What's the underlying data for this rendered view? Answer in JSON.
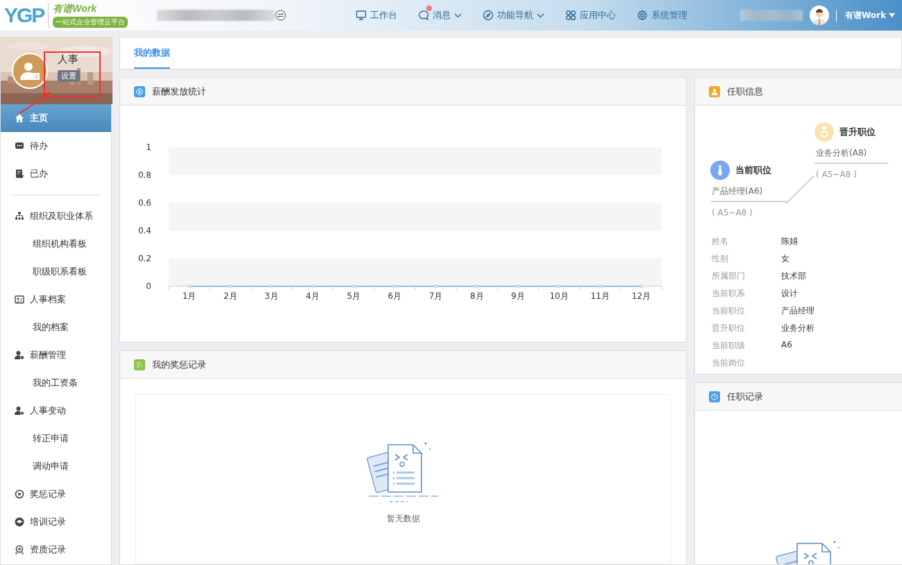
{
  "logo": {
    "mark": "YGP",
    "brand": "有谱Work",
    "tagline": "一站式企业管理云平台"
  },
  "nav": [
    {
      "label": "工作台",
      "dropdown": false,
      "badge": false
    },
    {
      "label": "消息",
      "dropdown": true,
      "badge": true
    },
    {
      "label": "功能导航",
      "dropdown": true,
      "badge": false
    },
    {
      "label": "应用中心",
      "dropdown": false,
      "badge": false
    },
    {
      "label": "系统管理",
      "dropdown": false,
      "badge": false
    }
  ],
  "account": {
    "label": "有谱Work"
  },
  "profile": {
    "name": "人事",
    "settings": "设置"
  },
  "sidebar": [
    {
      "kind": "item",
      "label": "主页",
      "selected": true
    },
    {
      "kind": "item",
      "label": "待办",
      "selected": false
    },
    {
      "kind": "item",
      "label": "已办",
      "selected": false
    },
    {
      "kind": "divider"
    },
    {
      "kind": "item",
      "label": "组织及职业体系",
      "selected": false
    },
    {
      "kind": "sub",
      "label": "组织机构看板",
      "selected": false
    },
    {
      "kind": "sub",
      "label": "职级职系看板",
      "selected": false
    },
    {
      "kind": "item",
      "label": "人事档案",
      "selected": false
    },
    {
      "kind": "sub",
      "label": "我的档案",
      "selected": false
    },
    {
      "kind": "item",
      "label": "薪酬管理",
      "selected": false
    },
    {
      "kind": "sub",
      "label": "我的工资条",
      "selected": false
    },
    {
      "kind": "item",
      "label": "人事变动",
      "selected": false
    },
    {
      "kind": "sub",
      "label": "转正申请",
      "selected": false
    },
    {
      "kind": "sub",
      "label": "调动申请",
      "selected": false
    },
    {
      "kind": "item",
      "label": "奖惩记录",
      "selected": false
    },
    {
      "kind": "item",
      "label": "培训记录",
      "selected": false
    },
    {
      "kind": "item",
      "label": "资质记录",
      "selected": false
    }
  ],
  "tabs": [
    {
      "label": "我的数据",
      "selected": true
    }
  ],
  "salary_panel": {
    "title": "薪酬发放统计",
    "chart_data": {
      "type": "line",
      "categories": [
        "1月",
        "2月",
        "3月",
        "4月",
        "5月",
        "6月",
        "7月",
        "8月",
        "9月",
        "10月",
        "11月",
        "12月"
      ],
      "series": [
        {
          "color": "#9bbcf0",
          "marker": true,
          "values": [
            0,
            0,
            0,
            0,
            0,
            0,
            0,
            0,
            0,
            0,
            0,
            0
          ]
        }
      ],
      "ylim": [
        0,
        1
      ],
      "yticks": [
        0,
        0.2,
        0.4,
        0.6,
        0.8,
        1
      ]
    }
  },
  "awards_panel": {
    "title": "我的奖惩记录",
    "empty": "暂无数据"
  },
  "job_panel": {
    "title": "任职信息",
    "current": {
      "heading": "当前职位",
      "position": "产品经理(A6)",
      "range": "( A5~A8 )"
    },
    "promotion": {
      "heading": "晋升职位",
      "position": "业务分析(A8)",
      "range": "( A5~A8 )"
    },
    "fields": [
      {
        "label": "姓名",
        "value": "陈娟"
      },
      {
        "label": "性别",
        "value": "女"
      },
      {
        "label": "所属部门",
        "value": "技术部"
      },
      {
        "label": "当前职系",
        "value": "设计"
      },
      {
        "label": "当前职位",
        "value": "产品经理"
      },
      {
        "label": "晋升职位",
        "value": "业务分析"
      },
      {
        "label": "当前职级",
        "value": "A6"
      },
      {
        "label": "当前岗位"
      }
    ]
  },
  "history_panel": {
    "title": "任职记录"
  }
}
